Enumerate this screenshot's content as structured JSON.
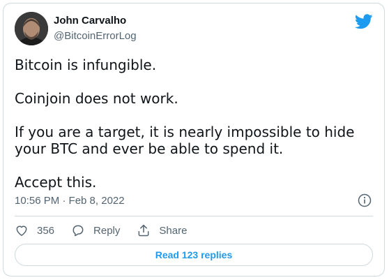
{
  "author": {
    "name": "John Carvalho",
    "handle": "@BitcoinErrorLog"
  },
  "tweet": {
    "paragraphs": [
      "Bitcoin is infungible.",
      "Coinjoin does not work.",
      "If you are a target, it is nearly impossible to hide your BTC and ever be able to spend it.",
      "Accept this."
    ],
    "timestamp": "10:56 PM · Feb 8, 2022"
  },
  "actions": {
    "likes": "356",
    "reply_label": "Reply",
    "share_label": "Share"
  },
  "read_replies_label": "Read 123 replies",
  "icons": {
    "brand": "twitter-bird-icon",
    "info": "info-icon",
    "like": "heart-icon",
    "reply": "reply-icon",
    "share": "share-icon"
  },
  "colors": {
    "accent": "#1d9bf0",
    "text": "#0f1419",
    "secondary_text": "#536471",
    "border": "#cfd9de"
  }
}
